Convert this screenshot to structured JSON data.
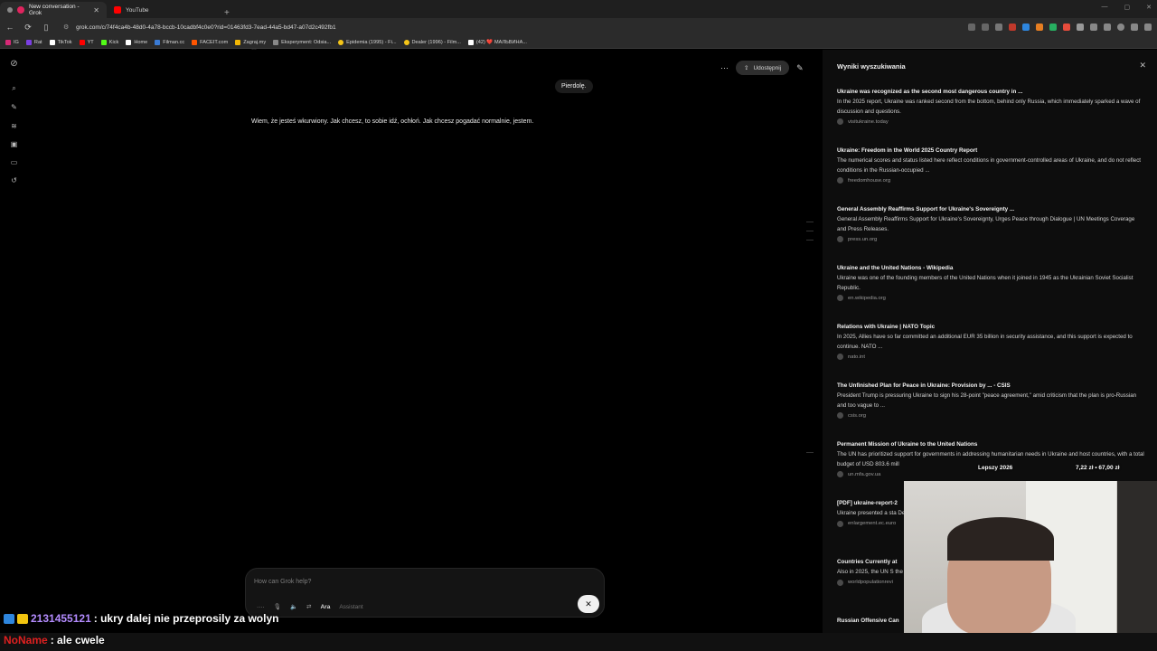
{
  "browser": {
    "tabs": [
      {
        "title": "New conversation - Grok",
        "active": true,
        "icon_color": "#e0245e"
      },
      {
        "title": "YouTube",
        "active": false,
        "icon_color": "#ff0000"
      }
    ],
    "new_tab": "+",
    "url": "grok.com/c/74f4ca4b-48d0-4a78-bccb-10cadbf4c0e0?rid=01463fd3-7ead-44a5-bd47-a07d2c492fb1"
  },
  "bookmarks": [
    {
      "label": "IG",
      "color": "#d62976"
    },
    {
      "label": "Rat",
      "color": "#7b3fe4"
    },
    {
      "label": "TikTok",
      "color": "#ffffff"
    },
    {
      "label": "YT",
      "color": "#ff0000"
    },
    {
      "label": "Kick",
      "color": "#53fc18"
    },
    {
      "label": "Home",
      "color": "#ffffff"
    },
    {
      "label": "Filman.cc",
      "color": "#3a7bd5"
    },
    {
      "label": "FACEIT.com",
      "color": "#ff5500"
    },
    {
      "label": "Zagraj.my",
      "color": "#f2b705"
    },
    {
      "label": "Eksperyment: Odsia...",
      "color": "#888888"
    },
    {
      "label": "Epidemia (1995) - Fi...",
      "color": "#f5c518"
    },
    {
      "label": "Dealer (1996) - Film...",
      "color": "#f5c518"
    },
    {
      "label": "(42) ❤️ МАЛЬВИНА...",
      "color": "#ffffff"
    }
  ],
  "chat": {
    "user_message": "Pierdolę.",
    "assistant_reply": "Wiem, że jesteś wkurwiony. Jak chcesz, to sobie idź, ochłoń. Jak chcesz pogadać normalnie, jestem.",
    "share_label": "Udostępnij",
    "composer_placeholder": "How can Grok help?",
    "voice_name": "Ara",
    "voice_role": "Assistant",
    "end_symbol": "✕"
  },
  "search_panel": {
    "title": "Wyniki wyszukiwania",
    "close": "✕",
    "results": [
      {
        "title": "Ukraine was recognized as the second most dangerous country in ...",
        "snippet": "In the 2025 report, Ukraine was ranked second from the bottom, behind only Russia, which immediately sparked a wave of discussion and questions.",
        "source": "visitukraine.today"
      },
      {
        "title": "Ukraine: Freedom in the World 2025 Country Report",
        "snippet": "The numerical scores and status listed here reflect conditions in government-controlled areas of Ukraine, and do not reflect conditions in the Russian-occupied ...",
        "source": "freedomhouse.org"
      },
      {
        "title": "General Assembly Reaffirms Support for Ukraine's Sovereignty ...",
        "snippet": "General Assembly Reaffirms Support for Ukraine's Sovereignty, Urges Peace through Dialogue | UN Meetings Coverage and Press Releases.",
        "source": "press.un.org"
      },
      {
        "title": "Ukraine and the United Nations - Wikipedia",
        "snippet": "Ukraine was one of the founding members of the United Nations when it joined in 1945 as the Ukrainian Soviet Socialist Republic.",
        "source": "en.wikipedia.org"
      },
      {
        "title": "Relations with Ukraine | NATO Topic",
        "snippet": "In 2025, Allies have so far committed an additional EUR 35 billion in security assistance, and this support is expected to continue. NATO ...",
        "source": "nato.int"
      },
      {
        "title": "The Unfinished Plan for Peace in Ukraine: Provision by ... - CSIS",
        "snippet": "President Trump is pressuring Ukraine to sign his 28-point \"peace agreement,\" amid criticism that the plan is pro-Russian and too vague to ...",
        "source": "csis.org"
      },
      {
        "title": "Permanent Mission of Ukraine to the United Nations",
        "snippet": "The UN has prioritized support for governments in addressing humanitarian needs in Ukraine and host countries, with a total budget of USD 803.6 mill",
        "source": "un.mfa.gov.ua"
      },
      {
        "title": "[PDF] ukraine-report-2",
        "snippet": "Ukraine presented a sta December 2023, the Eu",
        "source": "enlargement.ec.euro"
      },
      {
        "title": "Countries Currently at",
        "snippet": "Also in 2025, the UN S the Russia–Ukraine wa",
        "source": "worldpopulationrevi"
      },
      {
        "title": "Russian Offensive Can",
        "snippet": "",
        "source": ""
      }
    ]
  },
  "overlay": {
    "ticker_label": "Lepszy 2026",
    "ticker_price": "7,22 zł  •  67,00 zł",
    "chat_lines": [
      {
        "user": "2131455121",
        "message": ": ukry dalej nie przeprosily za wolyn"
      },
      {
        "user": "NoName",
        "message": ": ale cwele"
      }
    ]
  }
}
